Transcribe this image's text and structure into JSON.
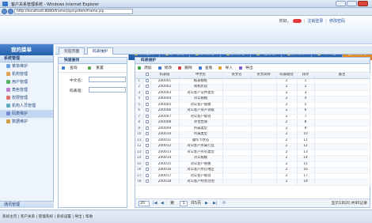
{
  "window": {
    "title": "客户关系管理系统 - Windows Internet Explorer",
    "url": "http://localhost:8080/frame/jsp/system/frame.jsp"
  },
  "header": {
    "user_greeting": "你好，",
    "badge": "",
    "links": [
      "注销登录",
      "修改密码"
    ]
  },
  "top_nav": [
    {
      "label": "我的首页"
    },
    {
      "label": "客户管理"
    },
    {
      "label": "营销管理"
    },
    {
      "label": "服务管理"
    },
    {
      "label": "产品管理"
    },
    {
      "label": "统计分析"
    },
    {
      "label": "工作平台"
    },
    {
      "label": "系统管理",
      "active": true
    }
  ],
  "sidebar": {
    "title": "我的菜单",
    "group": "系统管理",
    "items": [
      {
        "label": "菜单维护"
      },
      {
        "label": "机构管理"
      },
      {
        "label": "用户管理"
      },
      {
        "label": "角色管理"
      },
      {
        "label": "权限管理"
      },
      {
        "label": "机构人员管理"
      },
      {
        "label": "码表维护",
        "active": true
      },
      {
        "label": "数据维护"
      }
    ],
    "footer": "通讯管理"
  },
  "tabs": [
    {
      "label": "欢迎页面"
    },
    {
      "label": "码表维护",
      "active": true
    }
  ],
  "search_panel": {
    "title": "快速查找",
    "query_label": "查询",
    "reset_label": "重置",
    "fields": [
      {
        "label": "中文名：",
        "value": ""
      },
      {
        "label": "码表值：",
        "value": ""
      }
    ]
  },
  "grid": {
    "title": "码表维护",
    "toolbar": [
      "添加",
      "修改",
      "删除",
      "查看",
      "导入",
      "导出"
    ],
    "columns": [
      "码表值",
      "中文名",
      "英文名",
      "英文简称",
      "码表级别",
      "排序",
      "备注"
    ],
    "rows": [
      [
        "200001",
        "报表模板",
        "",
        "",
        "2",
        "1",
        ""
      ],
      [
        "200002",
        "商机阶段",
        "",
        "",
        "2",
        "2",
        ""
      ],
      [
        "200003",
        "对公客户证件类型",
        "",
        "",
        "2",
        "3",
        ""
      ],
      [
        "200004",
        "对公规模",
        "",
        "",
        "2",
        "4",
        ""
      ],
      [
        "200005",
        "对公客户规模",
        "",
        "",
        "2",
        "5",
        ""
      ],
      [
        "200006",
        "对公客户资产等级",
        "",
        "",
        "2",
        "6",
        ""
      ],
      [
        "200007",
        "对公客户级别",
        "",
        "",
        "2",
        "7",
        ""
      ],
      [
        "200008",
        "单位性质",
        "",
        "",
        "2",
        "8",
        ""
      ],
      [
        "200009",
        "所属类型",
        "",
        "",
        "2",
        "9",
        ""
      ],
      [
        "200010",
        "所属类型",
        "",
        "",
        "2",
        "10",
        ""
      ],
      [
        "200011",
        "操作卡状态",
        "",
        "",
        "2",
        "11",
        ""
      ],
      [
        "200012",
        "对公客户所属行业",
        "",
        "",
        "2",
        "12",
        ""
      ],
      [
        "200013",
        "对公客户所有类型",
        "",
        "",
        "2",
        "13",
        ""
      ],
      [
        "200014",
        "对公规模",
        "",
        "",
        "2",
        "14",
        ""
      ],
      [
        "200015",
        "对公客户规模",
        "",
        "",
        "2",
        "15",
        ""
      ],
      [
        "200016",
        "对公客户所在地区",
        "",
        "",
        "2",
        "16",
        ""
      ],
      [
        "200017",
        "对公客户级别",
        "",
        "",
        "2",
        "17",
        ""
      ],
      [
        "200018",
        "对公客户经营范围",
        "",
        "",
        "2",
        "18",
        ""
      ]
    ],
    "pager": {
      "page_size": "20",
      "page": "1",
      "total_pages_label": "共5页",
      "info": "显示1到20,共90记录"
    }
  },
  "status_bar": "系统主页 | 客户关系 | 管理系统 | 系统设置 | 导出 | 帮助"
}
